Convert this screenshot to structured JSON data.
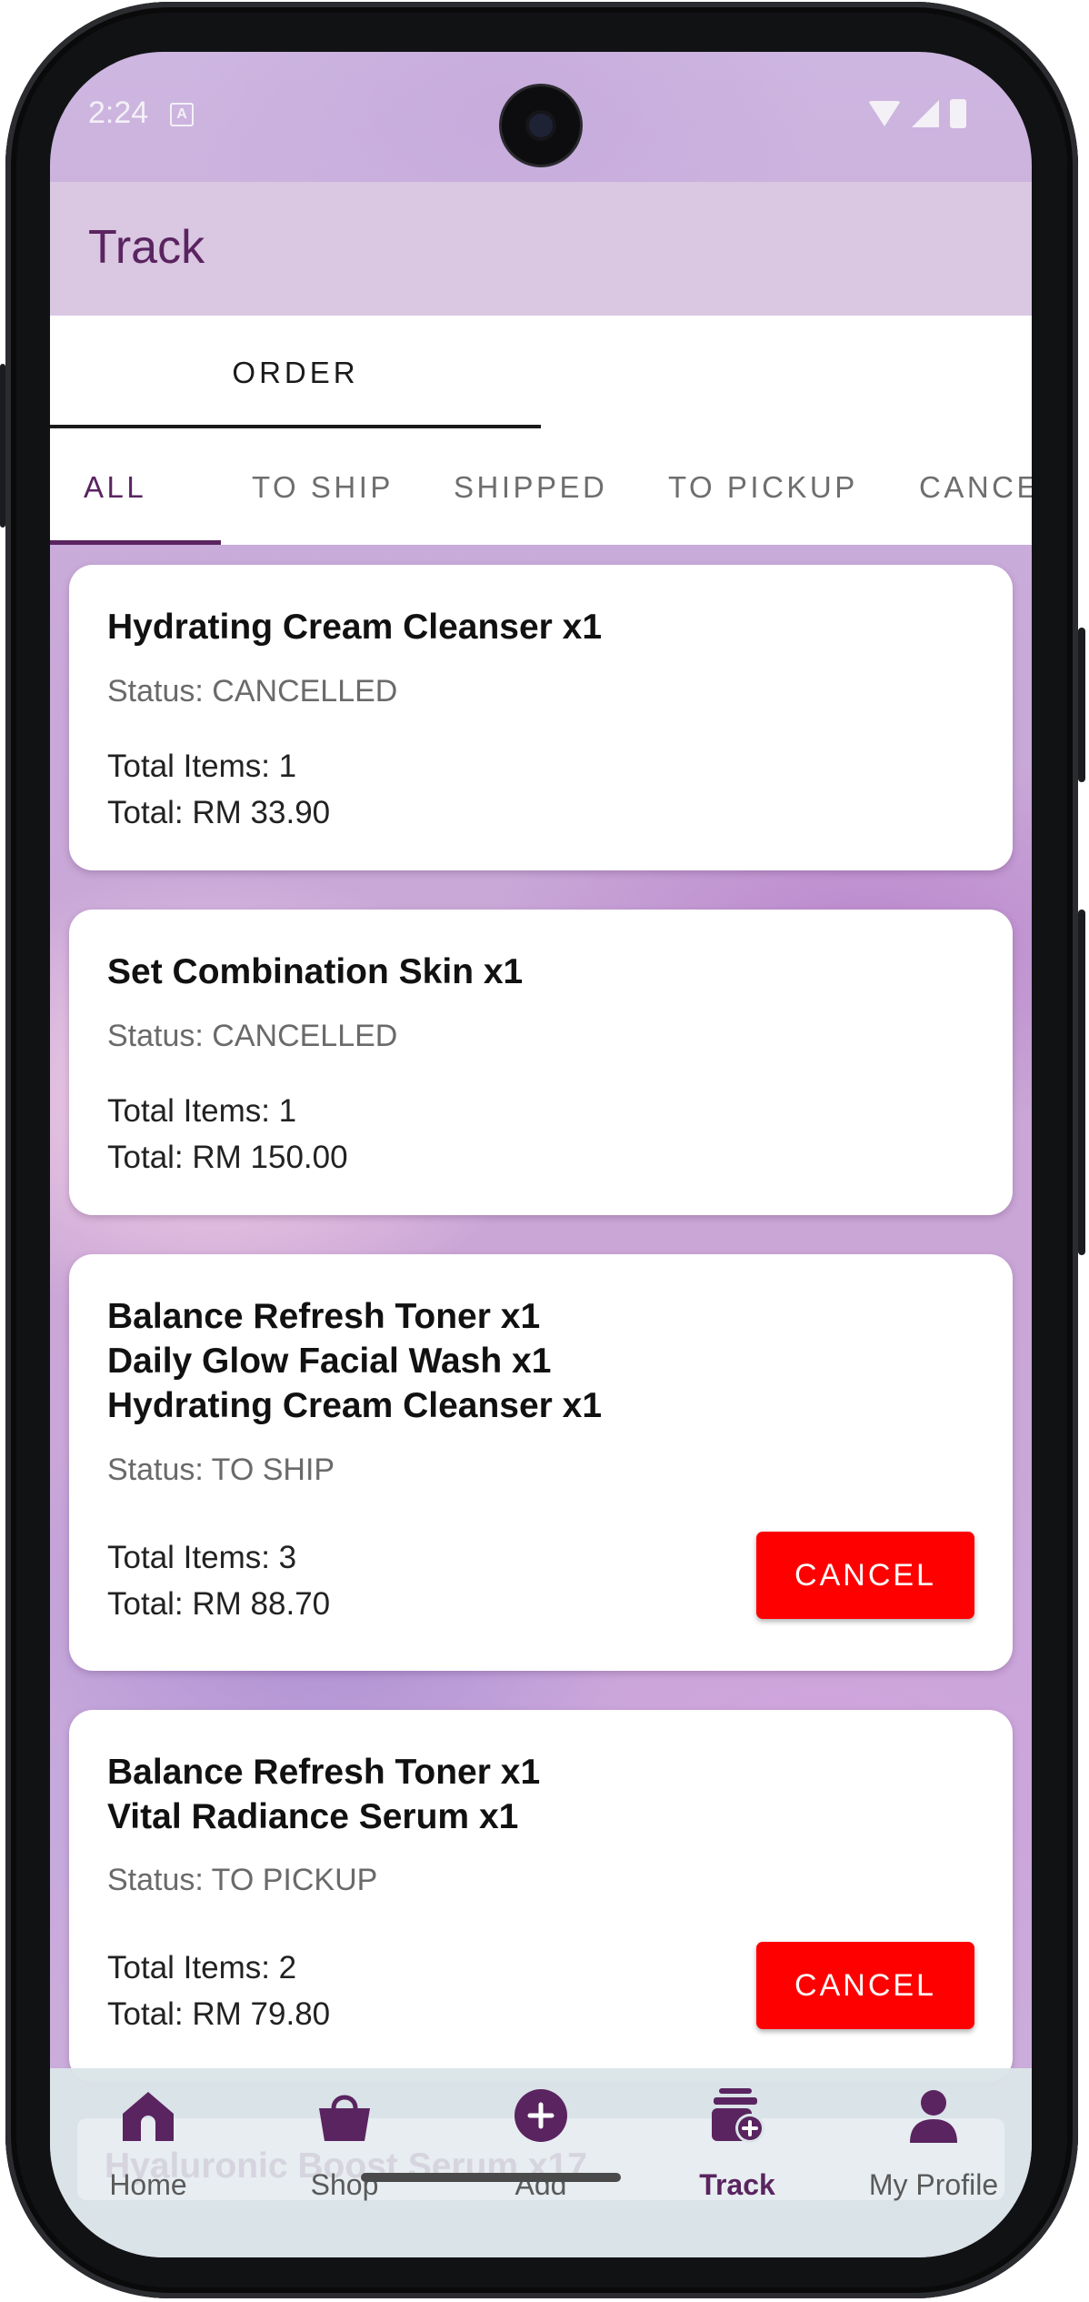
{
  "status_bar": {
    "time": "2:24",
    "a_badge": "A"
  },
  "app_bar": {
    "title": "Track"
  },
  "top_tabs": [
    {
      "label": "ORDER"
    }
  ],
  "sub_tabs": [
    {
      "label": "ALL",
      "active": true
    },
    {
      "label": "TO SHIP",
      "active": false
    },
    {
      "label": "SHIPPED",
      "active": false
    },
    {
      "label": "TO PICKUP",
      "active": false
    },
    {
      "label": "CANCE",
      "active": false
    }
  ],
  "orders": [
    {
      "items": [
        "Hydrating Cream Cleanser x1"
      ],
      "status": "Status: CANCELLED",
      "total_items": "Total Items: 1",
      "total": "Total: RM 33.90",
      "action": null
    },
    {
      "items": [
        "Set Combination Skin x1"
      ],
      "status": "Status: CANCELLED",
      "total_items": "Total Items: 1",
      "total": "Total: RM 150.00",
      "action": null
    },
    {
      "items": [
        "Balance Refresh Toner x1",
        "Daily Glow Facial Wash x1",
        "Hydrating Cream Cleanser x1"
      ],
      "status": "Status: TO SHIP",
      "total_items": "Total Items: 3",
      "total": "Total: RM 88.70",
      "action": "CANCEL"
    },
    {
      "items": [
        "Balance Refresh Toner x1",
        "Vital Radiance Serum x1"
      ],
      "status": "Status: TO PICKUP",
      "total_items": "Total Items: 2",
      "total": "Total: RM 79.80",
      "action": "CANCEL"
    }
  ],
  "behind_nav_text": "Hyaluronic Boost Serum x17",
  "bottom_nav": [
    {
      "label": "Home",
      "icon": "home-icon",
      "active": false
    },
    {
      "label": "Shop",
      "icon": "shopping-bag-icon",
      "active": false
    },
    {
      "label": "Add",
      "icon": "add-circle-icon",
      "active": false
    },
    {
      "label": "Track",
      "icon": "track-order-icon",
      "active": true
    },
    {
      "label": "My Profile",
      "icon": "person-icon",
      "active": false
    }
  ],
  "colors": {
    "brand": "#5a2460",
    "app_bar": "#dac7e2",
    "cancel_button": "#ff0000",
    "nav_background": "#dbe5e8"
  }
}
